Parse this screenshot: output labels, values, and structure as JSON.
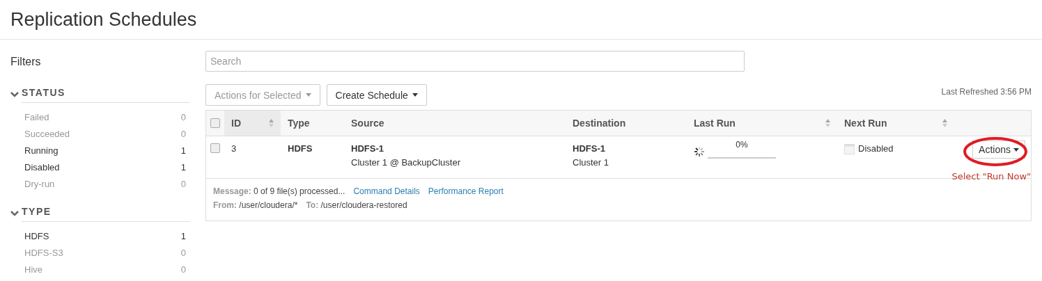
{
  "page_title": "Replication Schedules",
  "filters": {
    "title": "Filters",
    "groups": [
      {
        "label": "STATUS",
        "expanded": true,
        "items": [
          {
            "label": "Failed",
            "count": "0",
            "active": false
          },
          {
            "label": "Succeeded",
            "count": "0",
            "active": false
          },
          {
            "label": "Running",
            "count": "1",
            "active": true
          },
          {
            "label": "Disabled",
            "count": "1",
            "active": true
          },
          {
            "label": "Dry-run",
            "count": "0",
            "active": false
          }
        ]
      },
      {
        "label": "TYPE",
        "expanded": true,
        "items": [
          {
            "label": "HDFS",
            "count": "1",
            "active": true
          },
          {
            "label": "HDFS-S3",
            "count": "0",
            "active": false
          },
          {
            "label": "Hive",
            "count": "0",
            "active": false
          }
        ]
      }
    ]
  },
  "search": {
    "placeholder": "Search"
  },
  "toolbar": {
    "buttons": [
      {
        "label": "Actions for Selected",
        "disabled": true
      },
      {
        "label": "Create Schedule",
        "disabled": false
      }
    ],
    "last_refreshed": "Last Refreshed 3:56 PM"
  },
  "table": {
    "header_checked": false,
    "columns": [
      {
        "label": "ID",
        "sortable": true,
        "sorted": true
      },
      {
        "label": "Type",
        "sortable": false,
        "sorted": false
      },
      {
        "label": "Source",
        "sortable": false,
        "sorted": false
      },
      {
        "label": "Destination",
        "sortable": false,
        "sorted": false
      },
      {
        "label": "Last Run",
        "sortable": true,
        "sorted": false
      },
      {
        "label": "Next Run",
        "sortable": true,
        "sorted": false
      }
    ],
    "rows": [
      {
        "checked": false,
        "id": "3",
        "type": "HDFS",
        "source": "HDFS-1",
        "source_sub": "Cluster 1 @ BackupCluster",
        "destination": "HDFS-1",
        "destination_sub": "Cluster 1",
        "progress": {
          "level": 0,
          "reading": "0%"
        },
        "next_run": "Disabled",
        "action": "Actions",
        "message_label": "Message:",
        "message": "0 of 9 file(s) processed...",
        "links": [
          "Command Details",
          "Performance Report"
        ],
        "from_label": "From:",
        "from": "/user/cloudera/*",
        "to_label": "To:",
        "to": "/user/cloudera-restored"
      }
    ]
  },
  "annotation": {
    "text": "Select \"Run Now\""
  }
}
